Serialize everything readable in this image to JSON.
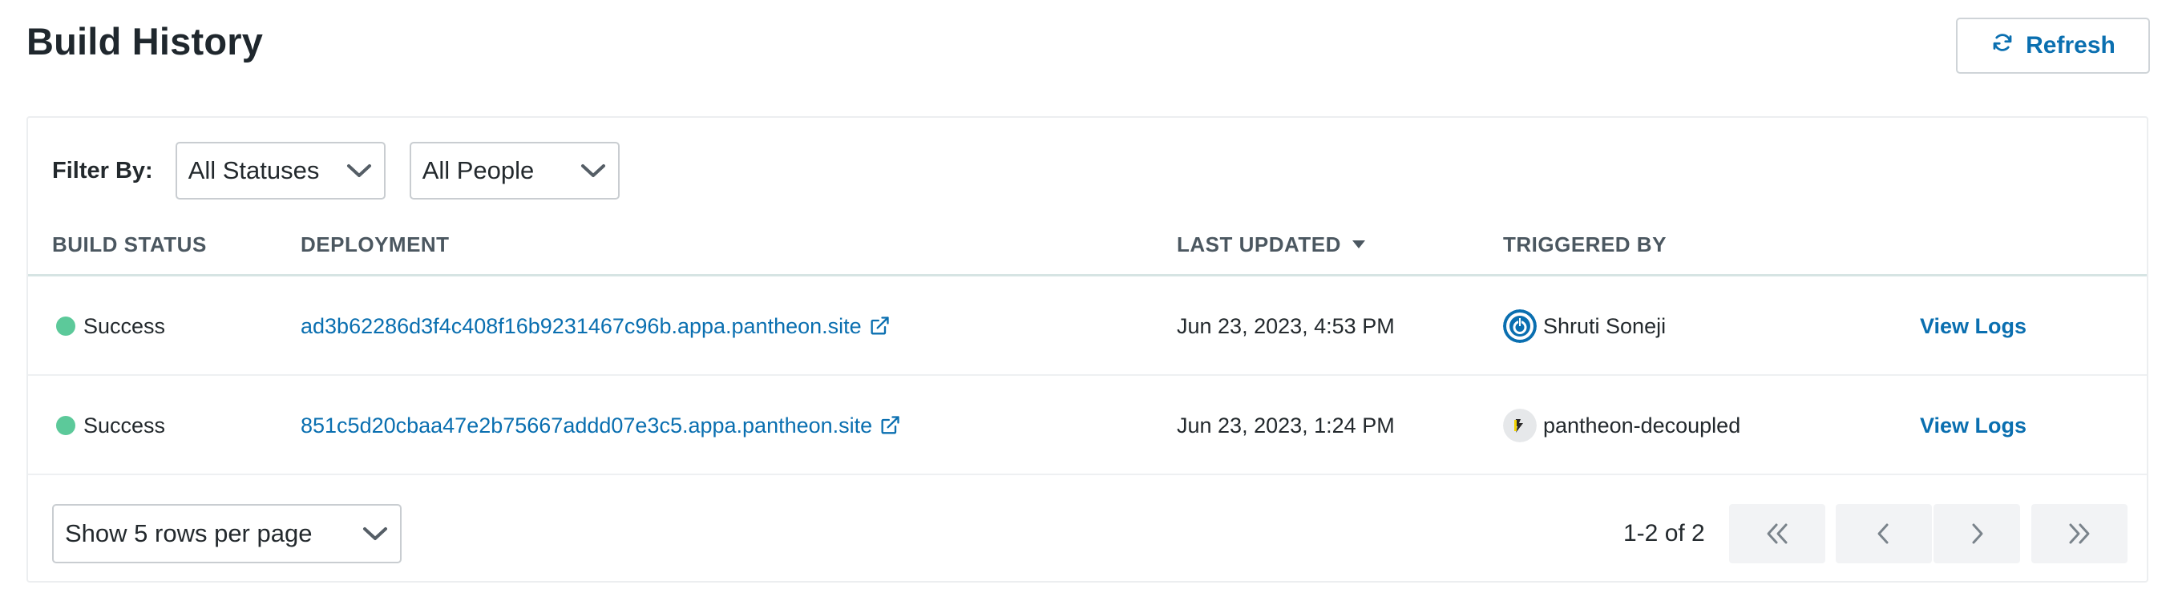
{
  "page": {
    "title": "Build History",
    "refresh_label": "Refresh"
  },
  "filters": {
    "label": "Filter By:",
    "status_value": "All Statuses",
    "people_value": "All People"
  },
  "table": {
    "columns": {
      "build_status": "BUILD STATUS",
      "deployment": "DEPLOYMENT",
      "last_updated": "LAST UPDATED",
      "triggered_by": "TRIGGERED BY"
    },
    "sort": {
      "column": "last_updated",
      "direction": "descending"
    },
    "rows": [
      {
        "status": "Success",
        "deployment": "ad3b62286d3f4c408f16b9231467c96b.appa.pantheon.site",
        "last_updated": "Jun 23, 2023, 4:53 PM",
        "triggered_by": "Shruti Soneji",
        "avatar_icon": "pantheon-power-avatar-icon",
        "action": "View Logs"
      },
      {
        "status": "Success",
        "deployment": "851c5d20cbaa47e2b75667addd07e3c5.appa.pantheon.site",
        "last_updated": "Jun 23, 2023, 1:24 PM",
        "triggered_by": "pantheon-decoupled",
        "avatar_icon": "pantheon-logo-avatar-icon",
        "action": "View Logs"
      }
    ]
  },
  "pagination": {
    "rows_per_page_value": "Show 5 rows per page",
    "range_text": "1-2 of 2"
  },
  "colors": {
    "accent": "#0a6fb0",
    "success": "#5cc99a",
    "pager_bg": "#f2f3f5"
  }
}
